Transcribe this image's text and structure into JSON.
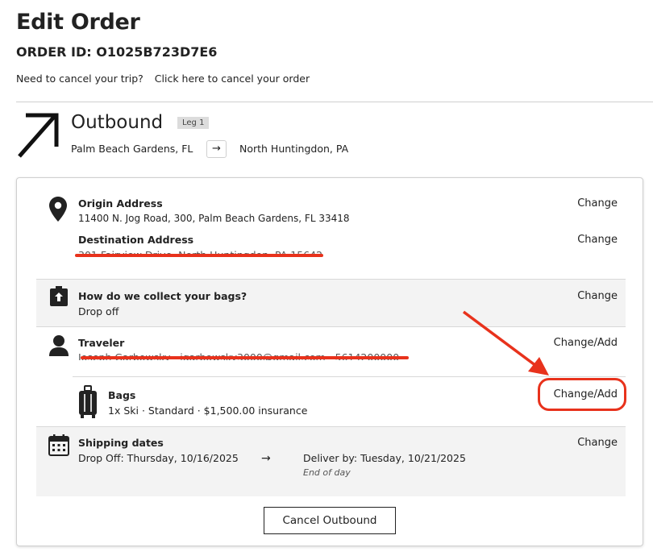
{
  "page": {
    "title": "Edit Order",
    "order_id": "ORDER ID: O1025B723D7E6",
    "cancel_prompt": "Need to cancel your trip?",
    "cancel_link": "Click here to cancel your order"
  },
  "leg": {
    "title": "Outbound",
    "badge": "Leg 1",
    "from": "Palm Beach Gardens, FL",
    "to_arrow": "→",
    "to": "North Huntingdon, PA"
  },
  "origin": {
    "label": "Origin Address",
    "value": "11400 N. Jog Road, 300, Palm Beach Gardens, FL 33418",
    "change": "Change"
  },
  "destination": {
    "label": "Destination Address",
    "value": "301 Fairview Drive, North Huntingdon, PA 15642",
    "change": "Change"
  },
  "collect": {
    "label": "How do we collect your bags?",
    "value": "Drop off",
    "change": "Change"
  },
  "traveler": {
    "label": "Traveler",
    "value": "Joseph Garbowsky · jgarbowsky3000@gmail.com · 5614200000",
    "change": "Change/Add"
  },
  "bags": {
    "label": "Bags",
    "value": "1x Ski · Standard · $1,500.00 insurance",
    "change": "Change/Add"
  },
  "shipping": {
    "label": "Shipping dates",
    "drop_off": "Drop Off: Thursday, 10/16/2025",
    "arrow": "→",
    "deliver_by": "Deliver by: Tuesday, 10/21/2025",
    "deliver_note": "End of day",
    "change": "Change"
  },
  "footer": {
    "cancel_button": "Cancel Outbound"
  },
  "colors": {
    "annotation_red": "#e8321c",
    "section_grey": "#f3f3f3"
  }
}
